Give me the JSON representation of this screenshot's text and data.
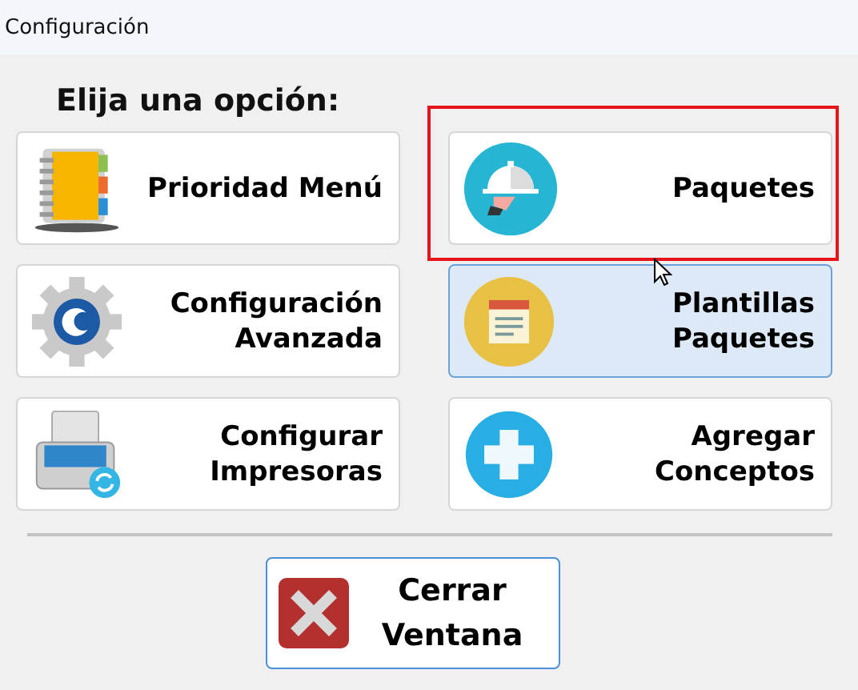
{
  "window": {
    "title": "Configuración"
  },
  "heading": "Elija una opción:",
  "options": [
    {
      "lines": [
        "Prioridad Menú"
      ],
      "focused": false,
      "highlighted": false
    },
    {
      "lines": [
        "Paquetes"
      ],
      "focused": false,
      "highlighted": true
    },
    {
      "lines": [
        "Configuración",
        "Avanzada"
      ],
      "focused": false,
      "highlighted": false
    },
    {
      "lines": [
        "Plantillas",
        "Paquetes"
      ],
      "focused": true,
      "highlighted": false
    },
    {
      "lines": [
        "Configurar",
        "Impresoras"
      ],
      "focused": false,
      "highlighted": false
    },
    {
      "lines": [
        "Agregar",
        "Conceptos"
      ],
      "focused": false,
      "highlighted": false
    }
  ],
  "close_button": {
    "lines": [
      "Cerrar",
      "Ventana"
    ]
  }
}
